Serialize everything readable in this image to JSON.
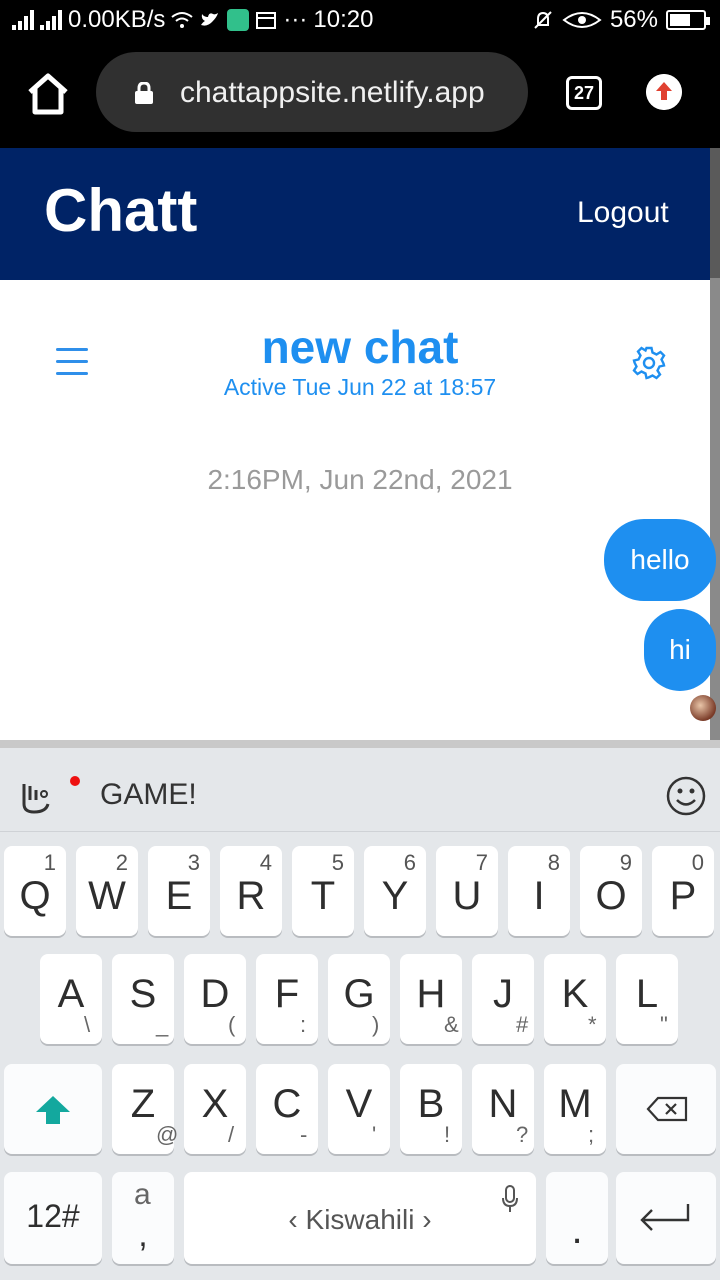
{
  "status_bar": {
    "network_speed": "0.00KB/s",
    "time": "10:20",
    "battery": "56%",
    "icons": [
      "signal-icon",
      "signal-icon",
      "wifi-icon",
      "twitter-icon",
      "app-icon",
      "calendar-icon",
      "more-icon",
      "mute-icon",
      "eye-icon",
      "battery-icon"
    ]
  },
  "browser": {
    "url": "chattappsite.netlify.app",
    "tab_count": "27"
  },
  "app": {
    "title": "Chatt",
    "logout_label": "Logout"
  },
  "chat": {
    "name": "new chat",
    "status": "Active Tue Jun 22 at 18:57",
    "timestamp": "2:16PM, Jun 22nd, 2021",
    "messages": [
      "hello",
      "hi"
    ]
  },
  "keyboard": {
    "suggestion": "GAME!",
    "rows": [
      [
        {
          "k": "Q",
          "h": "1"
        },
        {
          "k": "W",
          "h": "2"
        },
        {
          "k": "E",
          "h": "3"
        },
        {
          "k": "R",
          "h": "4"
        },
        {
          "k": "T",
          "h": "5"
        },
        {
          "k": "Y",
          "h": "6"
        },
        {
          "k": "U",
          "h": "7"
        },
        {
          "k": "I",
          "h": "8"
        },
        {
          "k": "O",
          "h": "9"
        },
        {
          "k": "P",
          "h": "0"
        }
      ],
      [
        {
          "k": "A",
          "s": "\\"
        },
        {
          "k": "S",
          "s": "_"
        },
        {
          "k": "D",
          "s": "("
        },
        {
          "k": "F",
          "s": ":"
        },
        {
          "k": "G",
          "s": ")"
        },
        {
          "k": "H",
          "s": "&"
        },
        {
          "k": "J",
          "s": "#"
        },
        {
          "k": "K",
          "s": "*"
        },
        {
          "k": "L",
          "s": "\""
        }
      ],
      [
        {
          "k": "Z",
          "s": "@"
        },
        {
          "k": "X",
          "s": "/"
        },
        {
          "k": "C",
          "s": "-"
        },
        {
          "k": "V",
          "s": "'"
        },
        {
          "k": "B",
          "s": "!"
        },
        {
          "k": "N",
          "s": "?"
        },
        {
          "k": "M",
          "s": ";"
        }
      ]
    ],
    "num_key": "12#",
    "comma_key": ",",
    "comma_hint": "a",
    "space_label": "Kiswahili",
    "period_key": "."
  },
  "colors": {
    "header_bg": "#002366",
    "accent": "#1e8ff0",
    "shift_arrow": "#13a89e"
  }
}
